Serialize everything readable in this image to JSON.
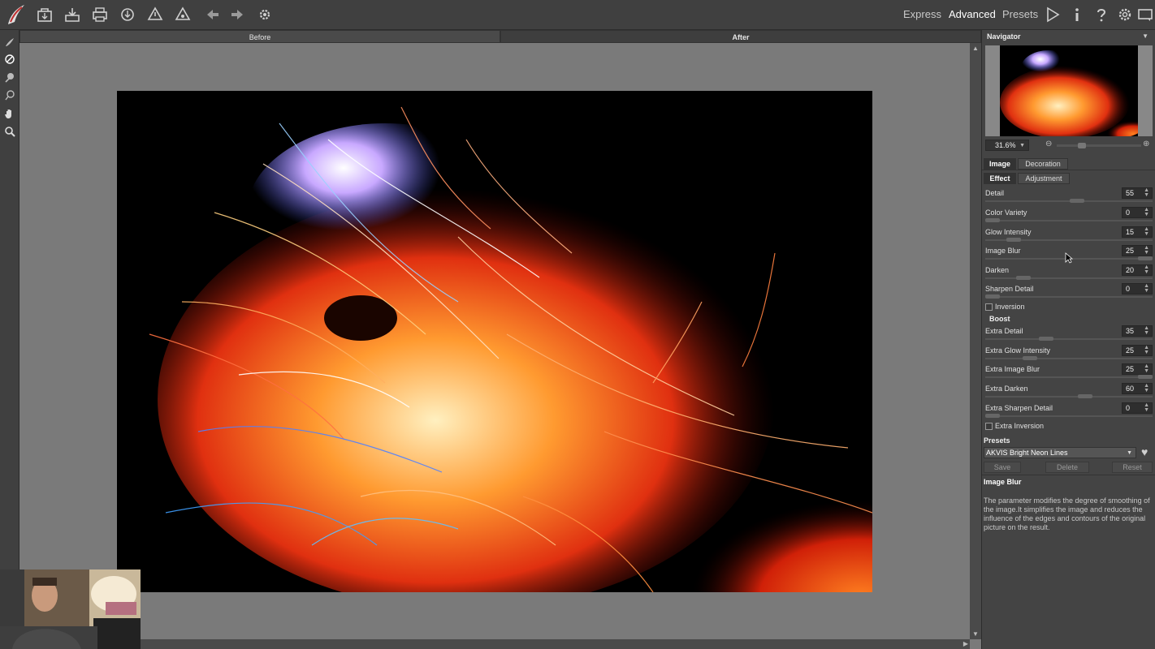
{
  "toolbar": {
    "modes": {
      "express": "Express",
      "advanced": "Advanced",
      "presets": "Presets"
    }
  },
  "viewer": {
    "tabs": {
      "before": "Before",
      "after": "After"
    }
  },
  "navigator": {
    "title": "Navigator",
    "zoom": "31.6%"
  },
  "panel": {
    "tabs": {
      "image": "Image",
      "decoration": "Decoration"
    },
    "subtabs": {
      "effect": "Effect",
      "adjustment": "Adjustment"
    },
    "params": [
      {
        "label": "Detail",
        "value": "55"
      },
      {
        "label": "Color Variety",
        "value": "0"
      },
      {
        "label": "Glow Intensity",
        "value": "15"
      },
      {
        "label": "Image Blur",
        "value": "25"
      },
      {
        "label": "Darken",
        "value": "20"
      },
      {
        "label": "Sharpen Detail",
        "value": "0"
      }
    ],
    "inversion_label": "Inversion",
    "boost_title": "Boost",
    "boost_params": [
      {
        "label": "Extra Detail",
        "value": "35"
      },
      {
        "label": "Extra Glow Intensity",
        "value": "25"
      },
      {
        "label": "Extra Image Blur",
        "value": "25"
      },
      {
        "label": "Extra Darken",
        "value": "60"
      },
      {
        "label": "Extra Sharpen Detail",
        "value": "0"
      }
    ],
    "extra_inversion_label": "Extra Inversion",
    "presets_title": "Presets",
    "preset_selected": "AKVIS Bright Neon Lines",
    "buttons": {
      "save": "Save",
      "delete": "Delete",
      "reset": "Reset"
    },
    "help": {
      "title": "Image Blur",
      "text": "The parameter modifies the degree of smoothing of the image.It simplifies the image and reduces the influence of the edges and contours of the original picture on the result."
    }
  }
}
